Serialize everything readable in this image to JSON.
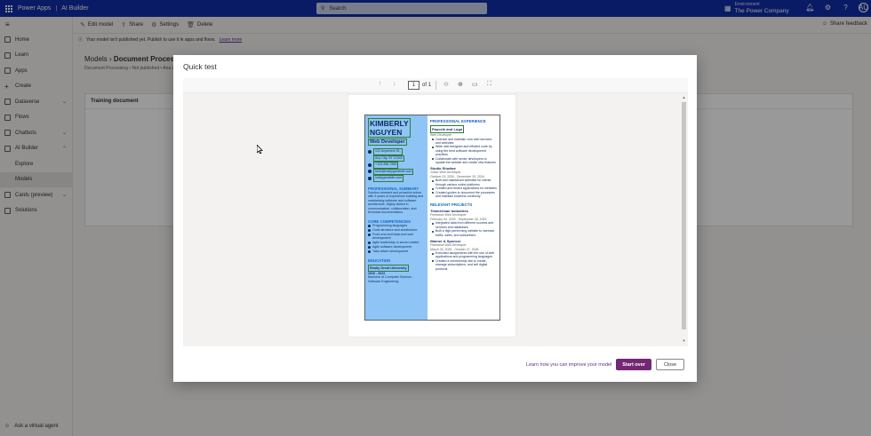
{
  "topbar": {
    "app": "Power Apps",
    "product": "AI Builder",
    "search_placeholder": "Search",
    "env_label": "Environment",
    "env_name": "The Power Company",
    "avatar": "AU"
  },
  "sidebar": {
    "items": [
      {
        "label": "Home"
      },
      {
        "label": "Learn"
      },
      {
        "label": "Apps"
      },
      {
        "label": "Create"
      },
      {
        "label": "Dataverse"
      },
      {
        "label": "Flows"
      },
      {
        "label": "Chatbots"
      },
      {
        "label": "AI Builder"
      },
      {
        "label": "Explore"
      },
      {
        "label": "Models"
      },
      {
        "label": "Cards (preview)"
      },
      {
        "label": "Solutions"
      }
    ],
    "ask": "Ask a virtual agent"
  },
  "cmdbar": {
    "edit": "Edit model",
    "share": "Share",
    "settings": "Settings",
    "delete": "Delete",
    "feedback": "Share feedback"
  },
  "infobar": {
    "text": "Your model isn't published yet. Publish to use it in apps and flows.",
    "link": "Learn more"
  },
  "background": {
    "models": "Models",
    "model_name": "Document Processi",
    "breadcrumb": "Document Processing  •  Not published  •  Ana L",
    "card_header": "Training document"
  },
  "dialog": {
    "title": "Quick test",
    "page_number": "1",
    "page_of": "of 1",
    "learn_link": "Learn how you can improve your model",
    "start_over": "Start over",
    "close": "Close"
  },
  "resume": {
    "first_name": "KIMBERLY",
    "last_name": "NGUYEN",
    "role": "Web Developer",
    "contact": [
      "123 Anywhere St.,",
      "Any City, ST 12345",
      "+123-456-7890",
      "hello@reallygreatsite.com",
      "reallygreatsite.com"
    ],
    "summary_h": "PROFESSIONAL SUMMARY",
    "summary": "Solution-oriented and proactive solver with 5 years of experience building and maintaining software and software architecture. Highly skilled in communication, collaboration, and technical documentation.",
    "competencies_h": "CORE COMPETENCIES",
    "competencies": [
      "Programming languages",
      "Code structure and architecture",
      "Front-end and back-end web development",
      "Agile leadership or scrum master",
      "Agile software development",
      "Task-driven development"
    ],
    "education_h": "EDUCATION",
    "school": "Really Great University",
    "years": "2020 - 2023",
    "degree": "Bachelor of Computer Science - Software Engineering",
    "exp_h": "PROFESSIONAL EXPERIENCE",
    "job1_company": "Pauceki and Logo",
    "job1_title": "Web Developer",
    "job1_bullets": [
      "Oversee and maintain core web services and websites",
      "Write well-designed and efficient code by using the best software development practices",
      "Collaborate with senior developers to update the website and create new features"
    ],
    "job2_company": "Studio Shodwe",
    "job2_title": "Junior Web Developer",
    "job2_date": "October 03, 2030 - December 29, 2034",
    "job2_bullets": [
      "Built and maintained websites for clients through various online platforms",
      "Created and tested applications for websites",
      "Created guides to document the processes and maintain business continuity"
    ],
    "projects_h": "RELEVANT PROJECTS",
    "proj1_company": "Timmerman Industries",
    "proj1_title": "Freelance Web Developer",
    "proj1_date": "February 04, 2029 - September 26, 2029",
    "proj1_bullets": [
      "Integrated data from different sources and services and databases",
      "Built a high-performing website to increase traffic, sales, and subscribers"
    ],
    "proj2_company": "Warner & Spencer",
    "proj2_title": "Freelance Web Developer",
    "proj2_date": "March 03, 2026 - October 27, 2026",
    "proj2_bullets": [
      "Executed assignments with the use of web applications and programming languages",
      "Created a membership site to create, manage subscriptions, and sell digital products"
    ]
  }
}
